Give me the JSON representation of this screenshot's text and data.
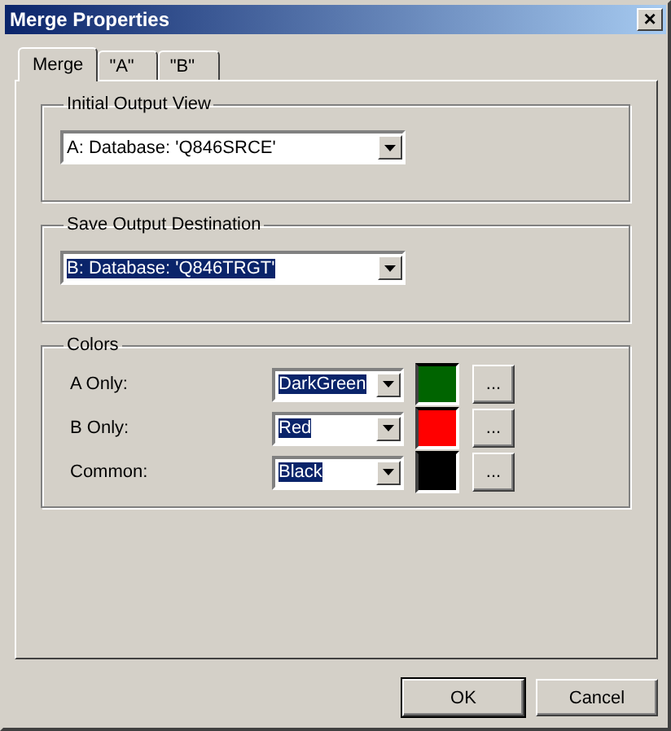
{
  "window": {
    "title": "Merge Properties",
    "close": "×"
  },
  "tabs": [
    {
      "label": "Merge",
      "selected": true
    },
    {
      "label": "\"A\"",
      "selected": false
    },
    {
      "label": "\"B\"",
      "selected": false
    }
  ],
  "groups": [
    {
      "title": "Initial Output View",
      "dropdown": {
        "value": "A: Database: 'Q846SRCE'",
        "highlighted": false
      }
    },
    {
      "title": "Save Output Destination",
      "dropdown": {
        "value": "B: Database: 'Q846TRGT'",
        "highlighted": true
      }
    }
  ],
  "colors": {
    "title": "Colors",
    "rows": [
      {
        "label": "A Only:",
        "value": "DarkGreen",
        "highlighted": true,
        "color": "#006400",
        "browse": "..."
      },
      {
        "label": "B Only:",
        "value": "Red",
        "highlighted": true,
        "color": "#ff0000",
        "browse": "..."
      },
      {
        "label": "Common:",
        "value": "Black",
        "highlighted": true,
        "color": "#000000",
        "browse": "..."
      }
    ]
  },
  "buttons": [
    {
      "label": "OK",
      "default": true
    },
    {
      "label": "Cancel",
      "default": false
    }
  ]
}
